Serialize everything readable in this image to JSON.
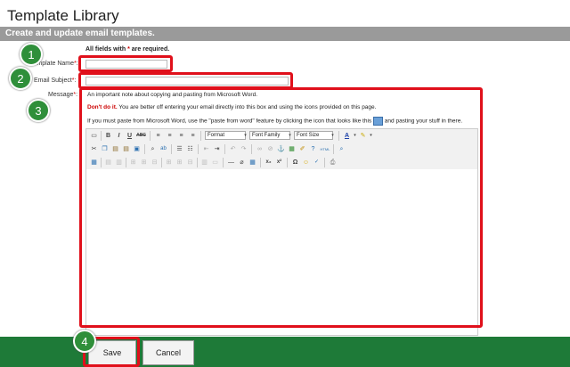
{
  "page_title": "Template Library",
  "subtitle": "Create and update email templates.",
  "required_note": {
    "prefix": "All fields with",
    "star": "*",
    "suffix": "are required."
  },
  "fields": {
    "template_name": {
      "label": "Template Name",
      "star": "*",
      "value": ""
    },
    "email_subject": {
      "label": "Email Subject",
      "star": "*",
      "value": ""
    },
    "message": {
      "label": "Message",
      "star": "*"
    }
  },
  "notes": {
    "line1": "An important note about copying and pasting from Microsoft Word.",
    "line2_bold": "Don't do it.",
    "line2_rest": "You are better off entering your email directly into this box and using the icons provided on this page.",
    "line3_a": "If you must paste from Microsoft Word, use the \"paste from word\" feature by clicking the icon that looks like this",
    "line3_b": "and pasting your stuff in there."
  },
  "toolbar": {
    "format": "Format",
    "font_family": "Font Family",
    "font_size": "Font Size",
    "buttons_row1": [
      "new-document",
      "bold",
      "italic",
      "underline",
      "strikethrough",
      "align-left",
      "align-center",
      "align-right",
      "justify"
    ],
    "buttons_row2": [
      "cut",
      "copy",
      "paste",
      "paste-text",
      "paste-from-word",
      "find",
      "replace",
      "bulleted-list",
      "numbered-list",
      "outdent",
      "indent",
      "undo",
      "redo",
      "link",
      "unlink",
      "anchor",
      "image",
      "cleanup",
      "help",
      "html",
      "preview"
    ],
    "buttons_row3": [
      "insert-table",
      "row-props",
      "cell-props",
      "insert-row-before",
      "insert-row-after",
      "delete-row",
      "insert-col-before",
      "insert-col-after",
      "delete-col",
      "split-cells",
      "merge-cells",
      "horizontal-rule",
      "remove-format",
      "visual-aid",
      "subscript",
      "superscript",
      "special-char",
      "emoticons",
      "spellcheck",
      "print"
    ]
  },
  "step_badges": [
    "1",
    "2",
    "3",
    "4"
  ],
  "buttons": {
    "save": "Save",
    "cancel": "Cancel"
  },
  "colors": {
    "highlight": "#e0101b",
    "badge": "#2f8f3a",
    "footer": "#1e7a38",
    "subbar": "#9a9a9a"
  }
}
